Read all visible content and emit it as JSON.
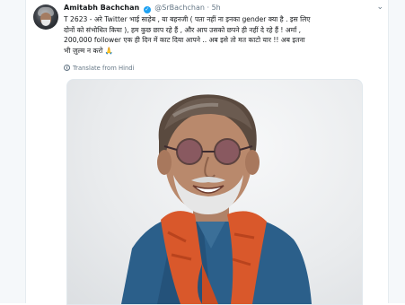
{
  "tweet": {
    "author_name": "Amitabh Bachchan",
    "handle": "@SrBachchan",
    "separator": "·",
    "time": "5h",
    "lines": [
      "T 2623 - अरे Twitter भाई साहेब , या बहनजी ( पता नहीं ना इनका gender क्या है . इस लिए",
      "दोनों को संभोधित किया ), हम कुछ छाप रहे हैं , और आप उसको छपने ही नहीं दे रहे हैं ! अर्मां ,",
      "200,000 follower एक ही दिन में काट दिया आपने .. अब इसे तो मत काटो यार !!  अब इतना",
      "भी ज़ुल्म न करो 🙏"
    ],
    "translate_label": "Translate from Hindi",
    "media_description": ""
  },
  "icons": {
    "verified": "verified-badge-icon",
    "caret": "chevron-down-icon",
    "translate": "globe-icon"
  },
  "colors": {
    "verified_blue": "#1da1f2",
    "muted_text": "#657786",
    "scarf": "#d9582b",
    "jacket": "#2b5f8a"
  }
}
